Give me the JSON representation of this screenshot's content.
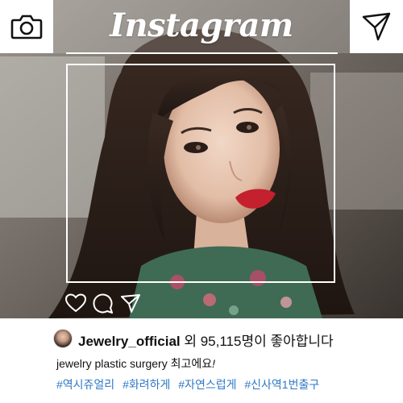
{
  "header": {
    "logo_text": "Instagram",
    "left_icon": "camera-icon",
    "right_icon": "send-icon"
  },
  "post": {
    "photo_subject": "portrait-photo",
    "actions": [
      "heart-icon",
      "comment-icon",
      "send-icon"
    ]
  },
  "caption": {
    "username": "Jewelry_official",
    "likes_text": " 외 95,115명이 좋아합니다",
    "description": "jewelry plastic surgery 최고에요",
    "description_end": "!",
    "hashtags": [
      "#역시쥬얼리",
      "#화려하게",
      "#자연스럽게",
      "#신사역1번출구"
    ]
  },
  "colors": {
    "hashtag": "#2f78c6",
    "frame": "#ffffff",
    "text": "#111111"
  }
}
